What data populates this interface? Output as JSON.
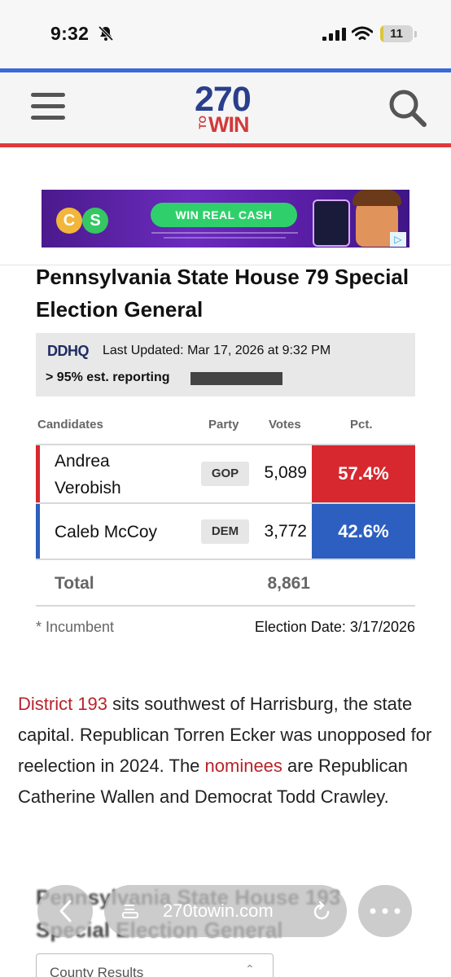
{
  "status": {
    "time": "9:32",
    "battery": "11"
  },
  "site": {
    "logo_top": "270",
    "logo_to": "TO",
    "logo_bottom": "WIN"
  },
  "ad": {
    "cta": "WIN REAL CASH",
    "coin_left": "C",
    "coin_right": "S"
  },
  "race": {
    "title": "Pennsylvania State House 79 Special Election General",
    "source": "DDHQ",
    "last_updated": "Last Updated: Mar 17, 2026 at 9:32 PM",
    "reporting": "> 95% est. reporting"
  },
  "table": {
    "headers": {
      "candidates": "Candidates",
      "party": "Party",
      "votes": "Votes",
      "pct": "Pct."
    },
    "rows": [
      {
        "name": "Andrea Verobish",
        "party": "GOP",
        "votes": "5,089",
        "pct": "57.4%",
        "color": "#d7282f"
      },
      {
        "name": "Caleb McCoy",
        "party": "DEM",
        "votes": "3,772",
        "pct": "42.6%",
        "color": "#2c5fbf"
      }
    ],
    "total_label": "Total",
    "total_votes": "8,861",
    "incumbent_note": "* Incumbent",
    "election_date": "Election Date: 3/17/2026"
  },
  "article": {
    "link1": "District 193",
    "text1": " sits southwest of Harrisburg, the state capital. Republican Torren Ecker was unopposed for reelection in 2024. The ",
    "link2": "nominees",
    "text2": " are Republican Catherine Wallen and Democrat Todd Crawley."
  },
  "next_section": {
    "title": "Pennsylvania State House 193 Special Election General",
    "county_label": "County Results"
  },
  "browser": {
    "url": "270towin.com"
  }
}
